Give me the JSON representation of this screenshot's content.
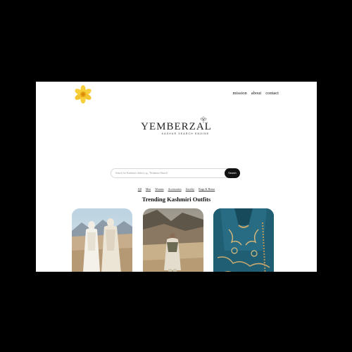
{
  "header": {
    "logo_icon": "daffodil-flower-icon",
    "nav": [
      "mission",
      "about",
      "contact"
    ]
  },
  "brand": {
    "name": "YEMBERZAL",
    "tagline": "KASHUR SEARCH ENGINE",
    "flower_icon": "line-flower-icon"
  },
  "search": {
    "placeholder": "Search for Kashmiri clothes e.g., 'Pashmina Shawls'",
    "button_label": "Search"
  },
  "filters": [
    "All",
    "Men",
    "Women",
    "Accessories",
    "Jewelry",
    "Rugs & Home"
  ],
  "trending": {
    "title": "Trending Kashmiri Outfits",
    "cards": [
      {
        "image": "two-women-in-white-pheran-desert"
      },
      {
        "image": "woman-in-shawl-mountain-valley"
      },
      {
        "image": "teal-embroidered-pheran-closeup"
      }
    ]
  },
  "colors": {
    "background": "#000000",
    "page": "#ffffff",
    "search_button": "#111111",
    "logo_yellow": "#f2c22c"
  }
}
